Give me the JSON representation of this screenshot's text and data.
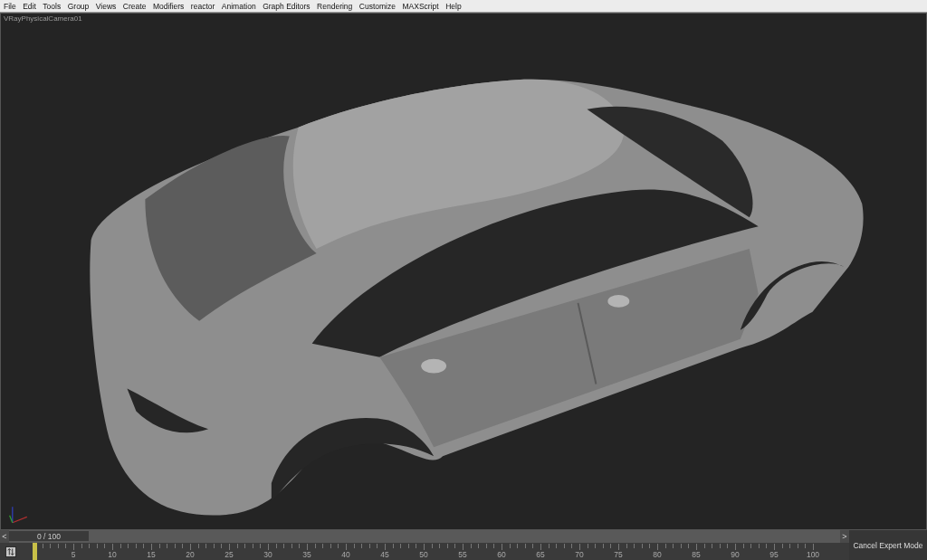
{
  "menu_bar": {
    "items": [
      "File",
      "Edit",
      "Tools",
      "Group",
      "Views",
      "Create",
      "Modifiers",
      "reactor",
      "Animation",
      "Graph Editors",
      "Rendering",
      "Customize",
      "MAXScript",
      "Help"
    ]
  },
  "viewport": {
    "label": "VRayPhysicalCamera01"
  },
  "time_slider": {
    "reading": "0 / 100",
    "level": 0,
    "prev": "<",
    "next": ">"
  },
  "track_bar": {
    "level": 0,
    "labels": [
      "5",
      "10",
      "15",
      "20",
      "25",
      "30",
      "35",
      "40",
      "45",
      "50",
      "55",
      "60",
      "65",
      "70",
      "75",
      "80",
      "85",
      "90",
      "95",
      "100"
    ]
  },
  "cancel_expert_mode": "Cancel Expert Mode"
}
